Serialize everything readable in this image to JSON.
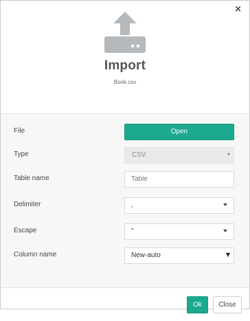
{
  "dialog": {
    "close_glyph": "×",
    "title": "Import",
    "filename": "Book.csv",
    "icon": "upload-tray-icon"
  },
  "form": {
    "file": {
      "label": "File",
      "button": "Open"
    },
    "type": {
      "label": "Type",
      "value": "CSV"
    },
    "table_name": {
      "label": "Table name",
      "placeholder": "Table"
    },
    "delimiter": {
      "label": "Delimiter",
      "value": ","
    },
    "escape": {
      "label": "Escape",
      "value": "\""
    },
    "column_name": {
      "label": "Column name",
      "value": "New-auto"
    }
  },
  "footer": {
    "ok": "Ok",
    "close": "Close"
  },
  "colors": {
    "accent": "#1ba98d",
    "icon": "#b5b9bc",
    "body_bg": "#f7f7f7"
  }
}
